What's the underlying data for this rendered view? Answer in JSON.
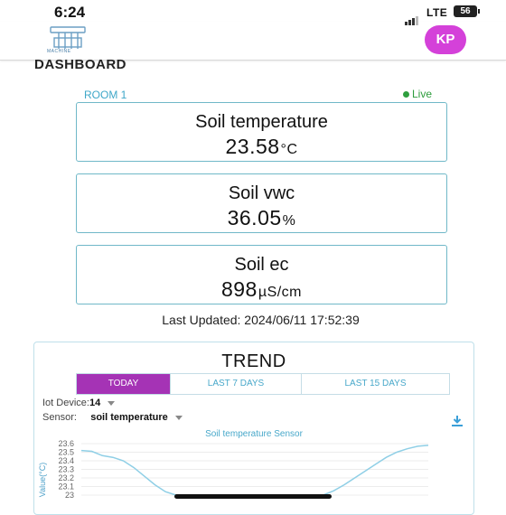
{
  "status_bar": {
    "time": "6:24",
    "network": "LTE",
    "battery": "56"
  },
  "app": {
    "logo_text": "MACHINE",
    "avatar_initials": "KP",
    "page_title": "DASHBOARD"
  },
  "room": {
    "name": "ROOM 1",
    "status": "Live",
    "status_color": "#2e9f3e"
  },
  "cards": [
    {
      "label": "Soil temperature",
      "value": "23.58",
      "unit": "°C"
    },
    {
      "label": "Soil vwc",
      "value": "36.05",
      "unit": "%"
    },
    {
      "label": "Soil ec",
      "value": "898",
      "unit": "µS/cm"
    }
  ],
  "last_updated": "Last Updated: 2024/06/11 17:52:39",
  "trend": {
    "title": "TREND",
    "tabs": [
      {
        "label": "TODAY",
        "active": true
      },
      {
        "label": "LAST 7 DAYS",
        "active": false
      },
      {
        "label": "LAST 15 DAYS",
        "active": false
      }
    ],
    "device_label": "Iot Device:",
    "device_value": "14",
    "sensor_label": "Sensor:",
    "sensor_value": "soil temperature"
  },
  "chart_data": {
    "type": "line",
    "title": "Soil temperature Sensor",
    "ylabel": "Value(°C)",
    "yticks": [
      "23.6",
      "23.5",
      "23.4",
      "23.3",
      "23.2",
      "23.1",
      "23"
    ],
    "ylim": [
      23.0,
      23.6
    ],
    "series": [
      {
        "values": [
          23.52,
          23.51,
          23.46,
          23.44,
          23.4,
          23.32,
          23.22,
          23.12,
          23.04,
          23.0,
          23.0,
          23.0,
          23.0,
          23.0,
          23.0,
          23.0,
          23.0,
          23.0,
          23.0,
          23.0,
          23.0,
          23.0,
          23.0,
          23.0,
          23.05,
          23.12,
          23.2,
          23.28,
          23.36,
          23.44,
          23.5,
          23.54,
          23.57,
          23.58
        ]
      }
    ],
    "line_color": "#8fcfe6"
  }
}
